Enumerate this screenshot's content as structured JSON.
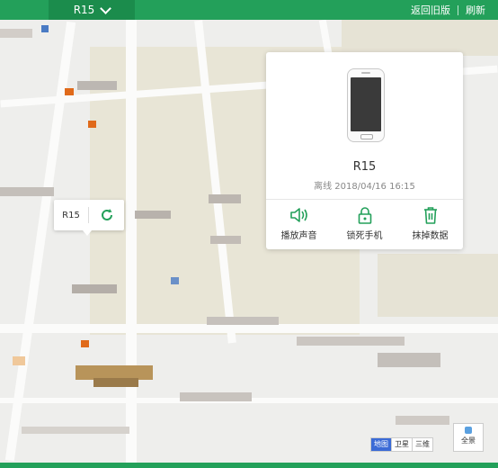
{
  "topbar": {
    "device_name": "R15",
    "links": [
      {
        "label": "返回旧版"
      },
      {
        "label": "刷新"
      }
    ]
  },
  "popup": {
    "device_name": "R15",
    "status": "离线 2018/04/16 16:15",
    "actions": [
      {
        "label": "播放声音",
        "icon": "speaker-icon"
      },
      {
        "label": "锁死手机",
        "icon": "lock-icon"
      },
      {
        "label": "抹掉数据",
        "icon": "trash-icon"
      }
    ]
  },
  "marker": {
    "label": "R15",
    "icon": "refresh-icon"
  },
  "map_controls": {
    "map_types": [
      {
        "label": "地图",
        "active": true
      },
      {
        "label": "卫星",
        "active": false
      },
      {
        "label": "三维",
        "active": false
      }
    ],
    "panorama_label": "全景"
  },
  "colors": {
    "brand_green": "#23a05a",
    "map_type_active": "#3b6bd6"
  }
}
